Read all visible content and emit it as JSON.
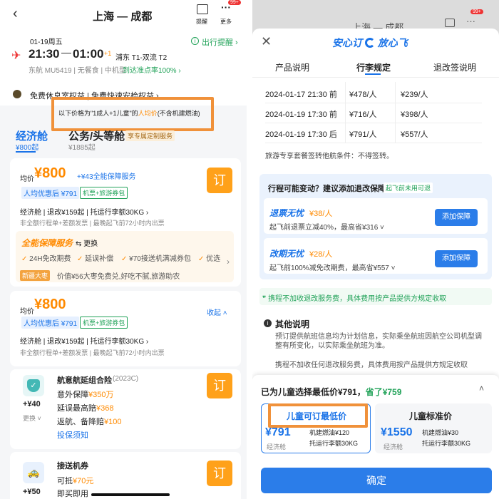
{
  "left": {
    "header": {
      "title": "上海 — 成都",
      "icon1_label": "提醒",
      "icon2_label": "更多",
      "badge": "99+"
    },
    "flight": {
      "date": "01-19周五",
      "reminder": "出行提醒",
      "dep_time": "21:30",
      "arr_time": "01:00",
      "plus_day": "+1",
      "airports": "浦东 T1-双流 T2",
      "airline_line": "东航 MU5419 | 无餐食 | 中机型",
      "ontime": "到达准点率100%",
      "benefits": "免费休息室权益 | 免费快速安检权益"
    },
    "price_note": {
      "prefix": "以下价格为\"1成人+1儿童\"的",
      "emph": "人均价",
      "suffix": "(不含机建燃油)"
    },
    "cabin_tabs": [
      {
        "name": "经济舱",
        "price": "¥800起"
      },
      {
        "name": "公务/头等舱",
        "price": "¥1885起",
        "tag": "享专属定制服务"
      }
    ],
    "offer1": {
      "avg_label": "均价",
      "price": "¥800",
      "plus_service": "+¥43全能保障服务",
      "discount": "人均优惠后 ¥791",
      "package": "机票+旅游券包",
      "detail": "经济舱 | 退改¥159起 | 托运行李额30KG",
      "note": "非全额行程单+差额发票 | 最晚起飞前72小时内出票",
      "book": "订",
      "service_name": "全能保障服务",
      "change": "更换",
      "items": [
        "24H免改期费",
        "延误补偿",
        "¥70接送机满减券包",
        "优选"
      ],
      "new_label": "新疆大枣",
      "new_desc": "价值¥56大枣免费兑,好吃不腻,旅游助农"
    },
    "offer2": {
      "avg_label": "均价",
      "price": "¥800",
      "discount": "人均优惠后 ¥791",
      "package": "机票+旅游券包",
      "collapse": "收起",
      "detail": "经济舱 | 退改¥159起 | 托运行李额30KG",
      "note": "非全额行程单+差额发票 | 最晚起飞前72小时内出票"
    },
    "insurance": {
      "title": "航意航延组合险",
      "code": "(2023C)",
      "l1_prefix": "意外保障",
      "l1_val": "¥350万",
      "l2_prefix": "延误最高赔",
      "l2_val": "¥368",
      "l3_prefix": "返航、备降赔",
      "l3_val": "¥100",
      "link": "投保须知",
      "price": "+¥40",
      "change": "更换",
      "book": "订"
    },
    "transfer": {
      "title": "接送机券",
      "l1_prefix": "可抵",
      "l1_val": "¥70元",
      "l2": "即买即用",
      "price": "+¥50",
      "book": "订"
    }
  },
  "right": {
    "bg_header": {
      "title": "上海 — 成都",
      "badge": "99+"
    },
    "modal": {
      "title_a": "安心订",
      "title_b": "放心飞",
      "tabs": [
        "产品说明",
        "行李规定",
        "退改签说明"
      ],
      "active_tab": 1,
      "table": [
        {
          "time": "2024-01-17 21:30 前",
          "adult": "¥478/人",
          "child": "¥239/人"
        },
        {
          "time": "2024-01-19 17:30 前",
          "adult": "¥716/人",
          "child": "¥398/人"
        },
        {
          "time": "2024-01-19 17:30 后",
          "adult": "¥791/人",
          "child": "¥557/人"
        }
      ],
      "sign_rule": "旅游专享套餐签转他航条件：不得签转。",
      "protect": {
        "title": "行程可能变动？建议添加退改保障",
        "tag": "起飞前未用可退",
        "items": [
          {
            "name": "退票无忧",
            "price": "¥38/人",
            "desc": "起飞前退票立减40%，最高省¥316",
            "btn": "添加保障"
          },
          {
            "name": "改期无忧",
            "price": "¥28/人",
            "desc": "起飞前100%减免改期费，最高省¥557",
            "btn": "添加保障"
          }
        ]
      },
      "refund_note": "携程不加收退改服务费，具体费用按产品提供方规定收取",
      "other": {
        "title": "其他说明",
        "p1": "预订提供航班信息均为计划信息，实际乘坐航班因航空公司机型调整有所变化，以实际乘坐航班为准。",
        "p2": "携程不加收任何退改服务费，具体费用按产品提供方规定收取"
      }
    },
    "summary": {
      "prefix": "已为儿童选择最低价¥791，",
      "saved": "省了¥759",
      "opt1": {
        "title": "儿童可订最低价",
        "price": "¥791",
        "cabin": "经济舱",
        "l1": "机建燃油¥120",
        "l2": "托运行李额30KG"
      },
      "opt2": {
        "title": "儿童标准价",
        "price": "¥1550",
        "cabin": "经济舱",
        "l1": "机建燃油¥30",
        "l2": "托运行李额30KG"
      },
      "confirm": "确定"
    }
  },
  "colors": {
    "orange": "#ff8a00",
    "blue": "#1a73e8",
    "highlight": "#f0913a",
    "button_orange": "#ffa11a",
    "confirm": "#2b7de9"
  }
}
